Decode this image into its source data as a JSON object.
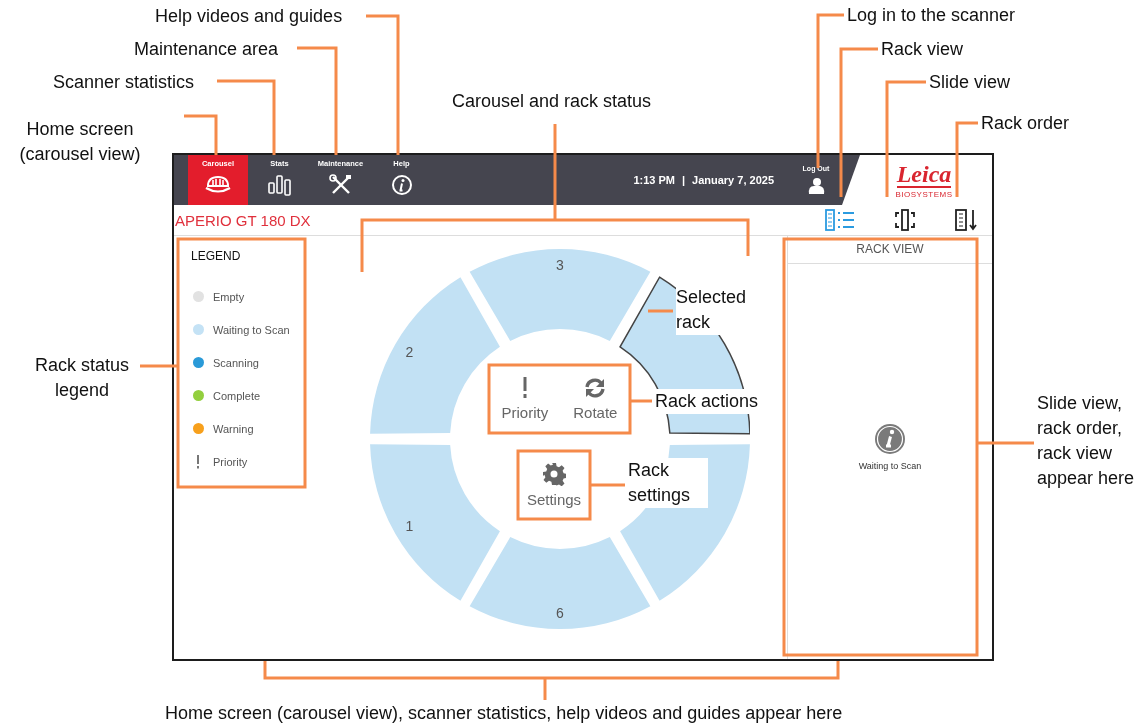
{
  "nav": {
    "tabs": [
      {
        "label": "Carousel",
        "selected": true
      },
      {
        "label": "Stats",
        "selected": false
      },
      {
        "label": "Maintenance",
        "selected": false
      },
      {
        "label": "Help",
        "selected": false
      }
    ],
    "time": "1:13 PM",
    "separator": "|",
    "date": "January 7, 2025",
    "logout": "Log Out",
    "logo": {
      "name": "Leica",
      "tagline": "BIOSYSTEMS"
    }
  },
  "header": {
    "instrument": "APERIO GT 180 DX",
    "views": [
      {
        "kind": "rack",
        "selected": true
      },
      {
        "kind": "slide",
        "selected": false
      },
      {
        "kind": "order",
        "selected": false
      }
    ]
  },
  "legend": {
    "title": "LEGEND",
    "items": [
      {
        "label": "Empty",
        "kind": "dot",
        "color": "#e2e2e2"
      },
      {
        "label": "Waiting to Scan",
        "kind": "dot",
        "color": "#c4e2f5"
      },
      {
        "label": "Scanning",
        "kind": "dot",
        "color": "#2a9ad8"
      },
      {
        "label": "Complete",
        "kind": "dot",
        "color": "#93cf3e"
      },
      {
        "label": "Warning",
        "kind": "dot",
        "color": "#f7a01c"
      },
      {
        "label": "Priority",
        "kind": "priority"
      }
    ]
  },
  "carousel": {
    "racks": [
      {
        "label": "1",
        "color": "#c2e1f4",
        "selected": false
      },
      {
        "label": "2",
        "color": "#c2e1f4",
        "selected": false
      },
      {
        "label": "3",
        "color": "#c2e1f4",
        "selected": false
      },
      {
        "color": "#c2e1f4",
        "selected": true
      },
      {
        "color": "#c2e1f4",
        "selected": false
      },
      {
        "label": "6",
        "color": "#c2e1f4",
        "selected": false
      }
    ],
    "actions": [
      {
        "label": "Priority",
        "kind": "priority"
      },
      {
        "label": "Rotate",
        "kind": "rotate"
      }
    ],
    "settings": "Settings"
  },
  "panel": {
    "title": "RACK VIEW",
    "message": "Waiting to Scan"
  },
  "callouts": [
    "Help videos and guides",
    "Maintenance area",
    "Scanner statistics",
    "Home screen (carousel view)",
    "Carousel and rack status",
    "Log in to the scanner",
    "Rack view",
    "Slide view",
    "Rack order",
    "Rack status legend",
    "Selected rack",
    "Rack actions",
    "Rack settings",
    "Slide view, rack order, rack view appear here",
    "Home screen (carousel view), scanner statistics, help videos and guides appear here"
  ]
}
